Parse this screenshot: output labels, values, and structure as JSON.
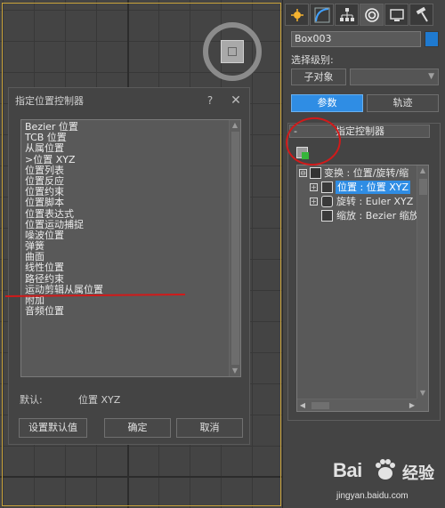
{
  "dialog": {
    "title": "指定位置控制器",
    "help_icon": "?",
    "close_icon": "✕",
    "items": [
      "Bezier 位置",
      "TCB 位置",
      "从属位置",
      ">位置 XYZ",
      "位置列表",
      "位置反应",
      "位置约束",
      "位置脚本",
      "位置表达式",
      "位置运动捕捉",
      "噪波位置",
      "弹簧",
      "曲面",
      "线性位置",
      "路径约束",
      "运动剪辑从属位置",
      "附加",
      "音频位置"
    ],
    "default_label": "默认:",
    "default_value": "位置 XYZ",
    "set_default_button": "设置默认值",
    "ok_button": "确定",
    "cancel_button": "取消"
  },
  "panel": {
    "object_name": "Box003",
    "object_color": "#1f7ad0",
    "selection_level_label": "选择级别:",
    "subobject_button": "子对象",
    "tabs": {
      "parameters": "参数",
      "trajectories": "轨迹"
    },
    "rollout": {
      "collapse_symbol": "-",
      "title": "指定控制器"
    },
    "tree": [
      {
        "label": "变换 : 位置/旋转/缩",
        "expander": "⊖",
        "selected": false
      },
      {
        "label": "位置 : 位置 XYZ",
        "expander": "+",
        "selected": true
      },
      {
        "label": "旋转 : Euler XYZ",
        "expander": "+",
        "selected": false
      },
      {
        "label": "缩放 : Bezier 缩放",
        "expander": "",
        "selected": false
      }
    ]
  },
  "watermark": {
    "brand": "Bai",
    "brand_suffix": "经验",
    "url": "jingyan.baidu.com"
  },
  "colors": {
    "accent": "#2f8de4",
    "annotation_red": "#d11a1a"
  }
}
